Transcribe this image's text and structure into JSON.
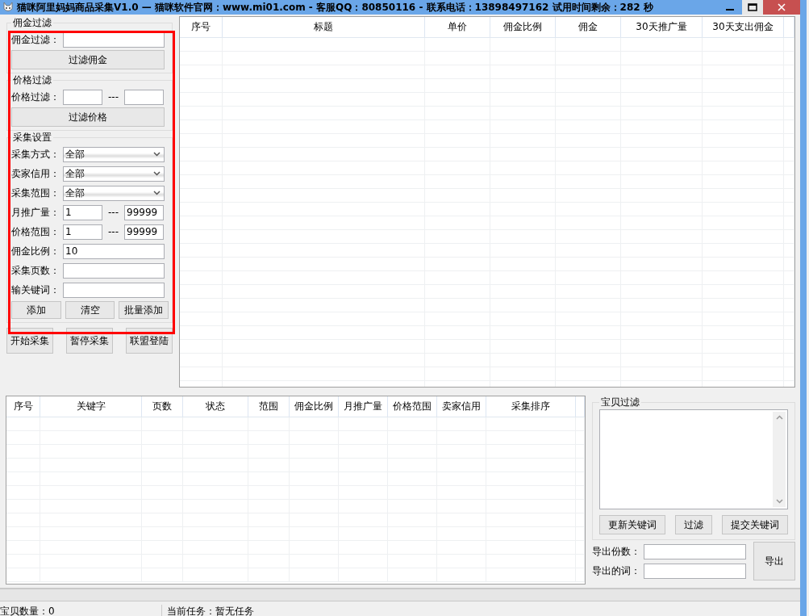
{
  "window": {
    "title": "猫咪阿里妈妈商品采集V1.0 — 猫咪软件官网：www.mi01.com - 客服QQ：80850116 - 联系电话：13898497162  试用时间剩余：282 秒"
  },
  "commission_filter": {
    "title": "佣金过滤",
    "label": "佣金过滤：",
    "button": "过滤佣金"
  },
  "price_filter": {
    "title": "价格过滤",
    "label": "价格过滤：",
    "separator": "---",
    "button": "过滤价格"
  },
  "collect_settings": {
    "title": "采集设置",
    "rows": [
      {
        "kind": "select",
        "label": "采集方式：",
        "value": "全部"
      },
      {
        "kind": "select",
        "label": "卖家信用：",
        "value": "全部"
      },
      {
        "kind": "select",
        "label": "采集范围：",
        "value": "全部"
      },
      {
        "kind": "range",
        "label": "月推广量：",
        "from": "1",
        "separator": "---",
        "to": "99999"
      },
      {
        "kind": "range",
        "label": "价格范围：",
        "from": "1",
        "separator": "---",
        "to": "99999"
      },
      {
        "kind": "input",
        "label": "佣金比例：",
        "value": "10"
      },
      {
        "kind": "input",
        "label": "采集页数："
      },
      {
        "kind": "input",
        "label": "输关键词："
      }
    ],
    "buttons": [
      "添加",
      "清空",
      "批量添加"
    ]
  },
  "actions": [
    "开始采集",
    "暂停采集",
    "联盟登陆"
  ],
  "results_table": {
    "columns": [
      "序号",
      "标题",
      "单价",
      "佣金比例",
      "佣金",
      "30天推广量",
      "30天支出佣金"
    ]
  },
  "keywords_table": {
    "columns": [
      "序号",
      "关键字",
      "页数",
      "状态",
      "范围",
      "佣金比例",
      "月推广量",
      "价格范围",
      "卖家信用",
      "采集排序"
    ]
  },
  "item_filter": {
    "title": "宝贝过滤",
    "buttons": [
      "更新关键词",
      "过滤",
      "提交关键词"
    ]
  },
  "export": {
    "fields": [
      {
        "label": "导出份数："
      },
      {
        "label": "导出的词："
      }
    ],
    "button": "导出"
  },
  "status_bar": [
    "宝贝数量：0",
    "当前任务：暂无任务"
  ]
}
